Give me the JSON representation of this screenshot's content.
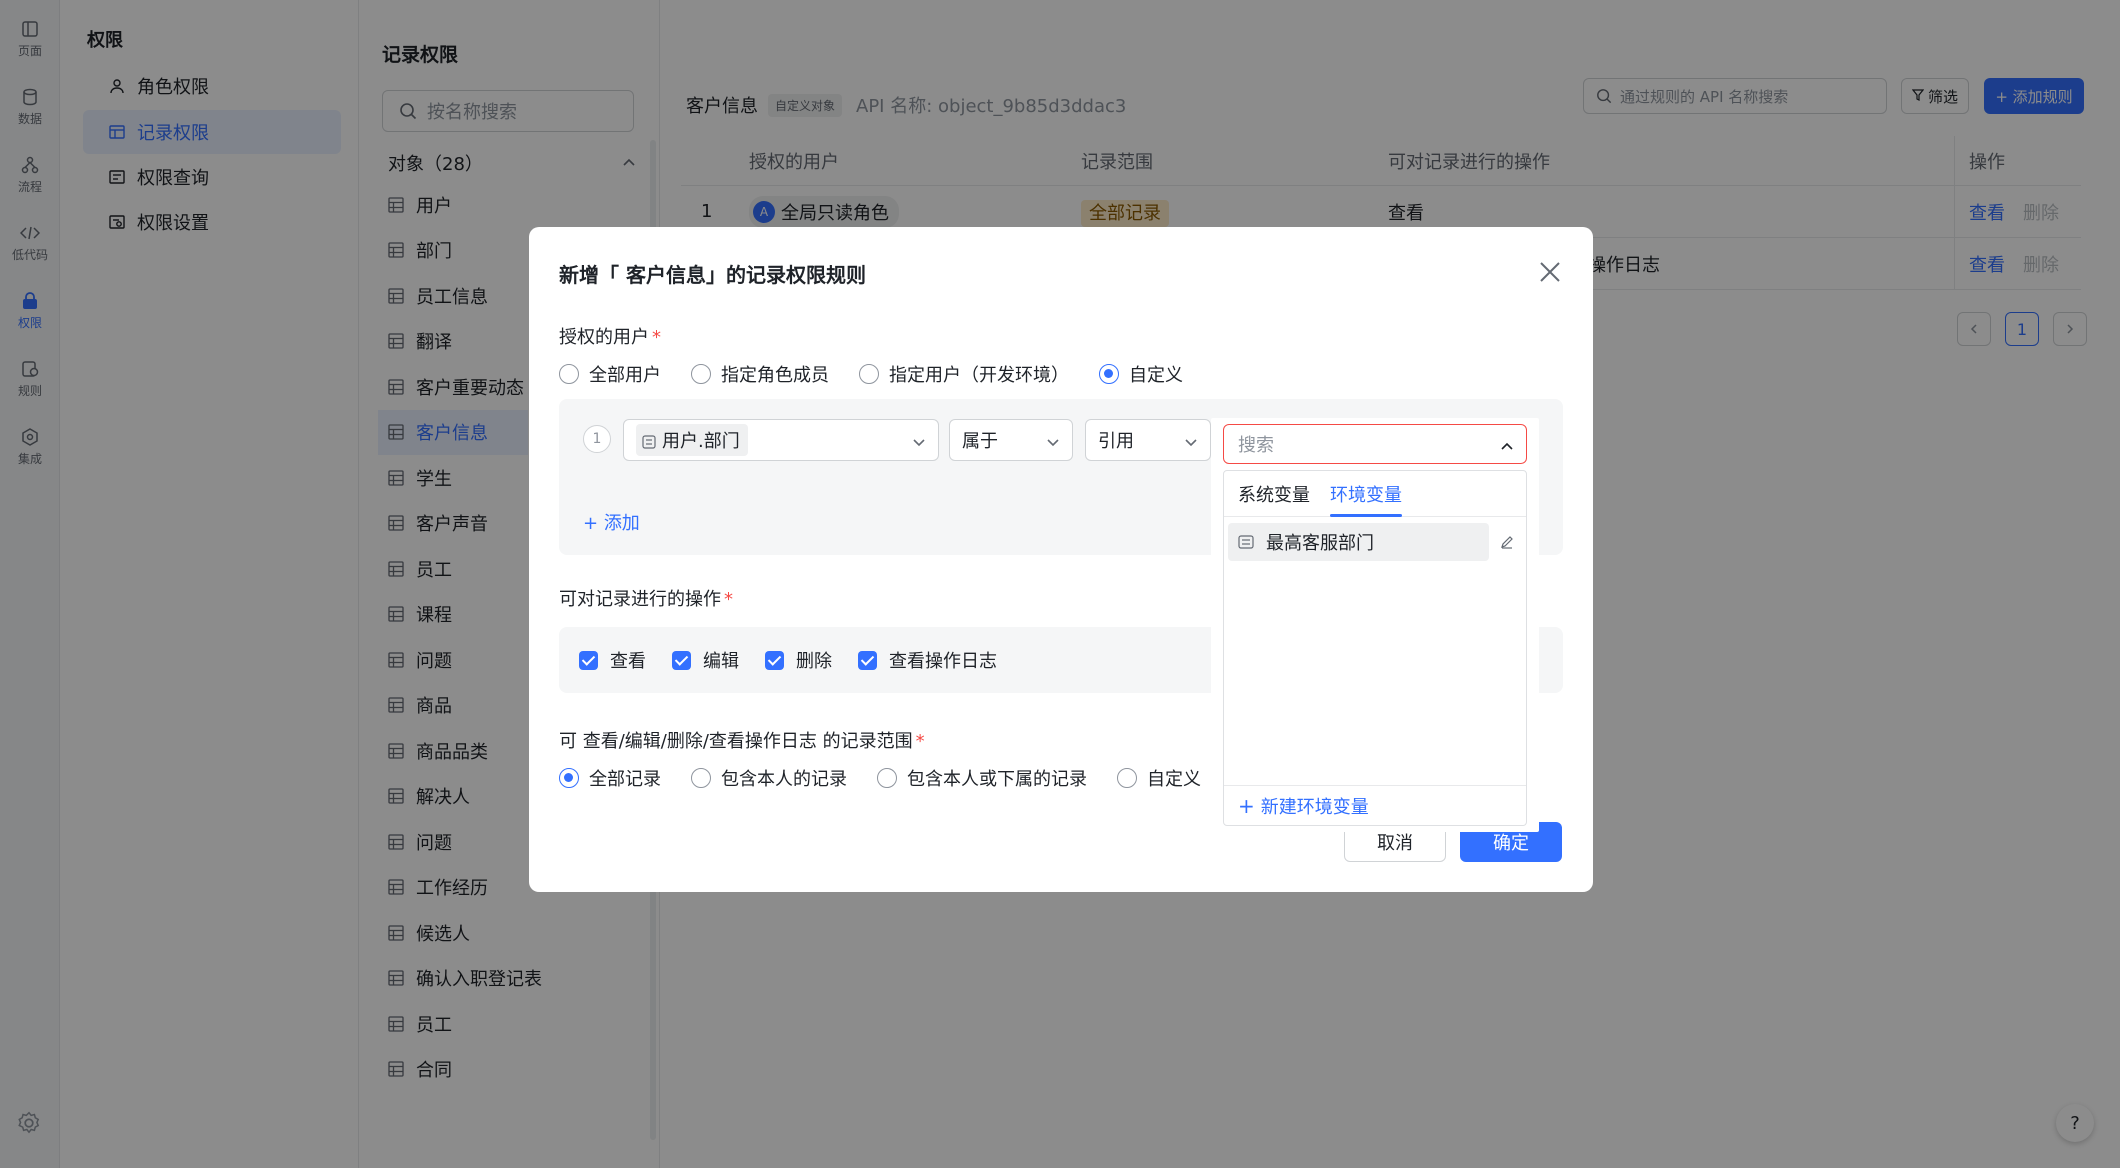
{
  "rail": {
    "items": [
      {
        "label": "页面",
        "icon": "page-icon"
      },
      {
        "label": "数据",
        "icon": "database-icon"
      },
      {
        "label": "流程",
        "icon": "flow-icon"
      },
      {
        "label": "低代码",
        "icon": "code-icon"
      },
      {
        "label": "权限",
        "icon": "lock-icon",
        "active": true
      },
      {
        "label": "规则",
        "icon": "rule-icon"
      },
      {
        "label": "集成",
        "icon": "integration-icon"
      }
    ]
  },
  "subnav": {
    "title": "权限",
    "items": [
      {
        "label": "角色权限",
        "icon": "user-icon"
      },
      {
        "label": "记录权限",
        "icon": "table-icon",
        "active": true
      },
      {
        "label": "权限查询",
        "icon": "query-icon"
      },
      {
        "label": "权限设置",
        "icon": "settings-icon"
      }
    ]
  },
  "objects": {
    "title": "记录权限",
    "search_placeholder": "按名称搜索",
    "group_label": "对象（28）",
    "items": [
      "用户",
      "部门",
      "员工信息",
      "翻译",
      "客户重要动态",
      "客户信息",
      "学生",
      "客户声音",
      "员工",
      "课程",
      "问题",
      "商品",
      "商品品类",
      "解决人",
      "问题",
      "工作经历",
      "候选人",
      "确认入职登记表",
      "员工",
      "合同"
    ],
    "active_index": 5
  },
  "main": {
    "object_name": "客户信息",
    "object_tag": "自定义对象",
    "api_name": "API 名称: object_9b85d3ddac3",
    "search_placeholder": "通过规则的 API 名称搜索",
    "filter_label": "筛选",
    "add_rule_label": "+ 添加规则",
    "columns": [
      "授权的用户",
      "记录范围",
      "可对记录进行的操作",
      "操作"
    ],
    "rows": [
      {
        "index": "1",
        "user": "全局只读角色",
        "scope": "全部记录",
        "ops": "查看",
        "view": "查看",
        "delete": "删除"
      },
      {
        "index": "",
        "user": "",
        "scope": "",
        "ops": "操作日志",
        "view": "查看",
        "delete": "删除"
      }
    ],
    "page": "1"
  },
  "modal": {
    "title": "新增「 客户信息」的记录权限规则",
    "users_label": "授权的用户",
    "user_options": [
      "全部用户",
      "指定角色成员",
      "指定用户（开发环境）",
      "自定义"
    ],
    "user_selected": 3,
    "condition": {
      "index": "1",
      "field": "用户.部门",
      "operator": "属于",
      "value_type": "引用"
    },
    "add_label": "添加",
    "ops_label": "可对记录进行的操作",
    "ops": [
      "查看",
      "编辑",
      "删除",
      "查看操作日志"
    ],
    "scope_label": "可 查看/编辑/删除/查看操作日志 的记录范围",
    "scope_options": [
      "全部记录",
      "包含本人的记录",
      "包含本人或下属的记录",
      "自定义"
    ],
    "scope_selected": 0,
    "cancel_label": "取消",
    "ok_label": "确定"
  },
  "popover": {
    "search_placeholder": "搜索",
    "tabs": [
      "系统变量",
      "环境变量"
    ],
    "active_tab": 1,
    "items": [
      {
        "label": "最高客服部门"
      }
    ],
    "footer_label": "新建环境变量"
  },
  "help_label": "?"
}
